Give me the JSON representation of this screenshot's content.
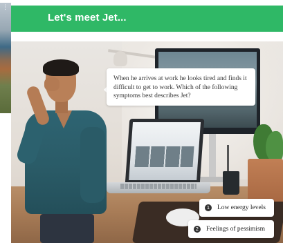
{
  "slide": {
    "title": "Let's meet Jet...",
    "header_color": "#2fb866",
    "bubble_text": "When he arrives at work he looks tired and finds it difficult to get to work. Which of the following symptoms best describes Jet?"
  },
  "options": [
    {
      "number": "1",
      "label": "Low energy levels"
    },
    {
      "number": "2",
      "label": "Feelings of pessimism"
    }
  ],
  "thumbnail": {
    "menu_icon": "more-vertical-icon",
    "dots": "⋮"
  }
}
